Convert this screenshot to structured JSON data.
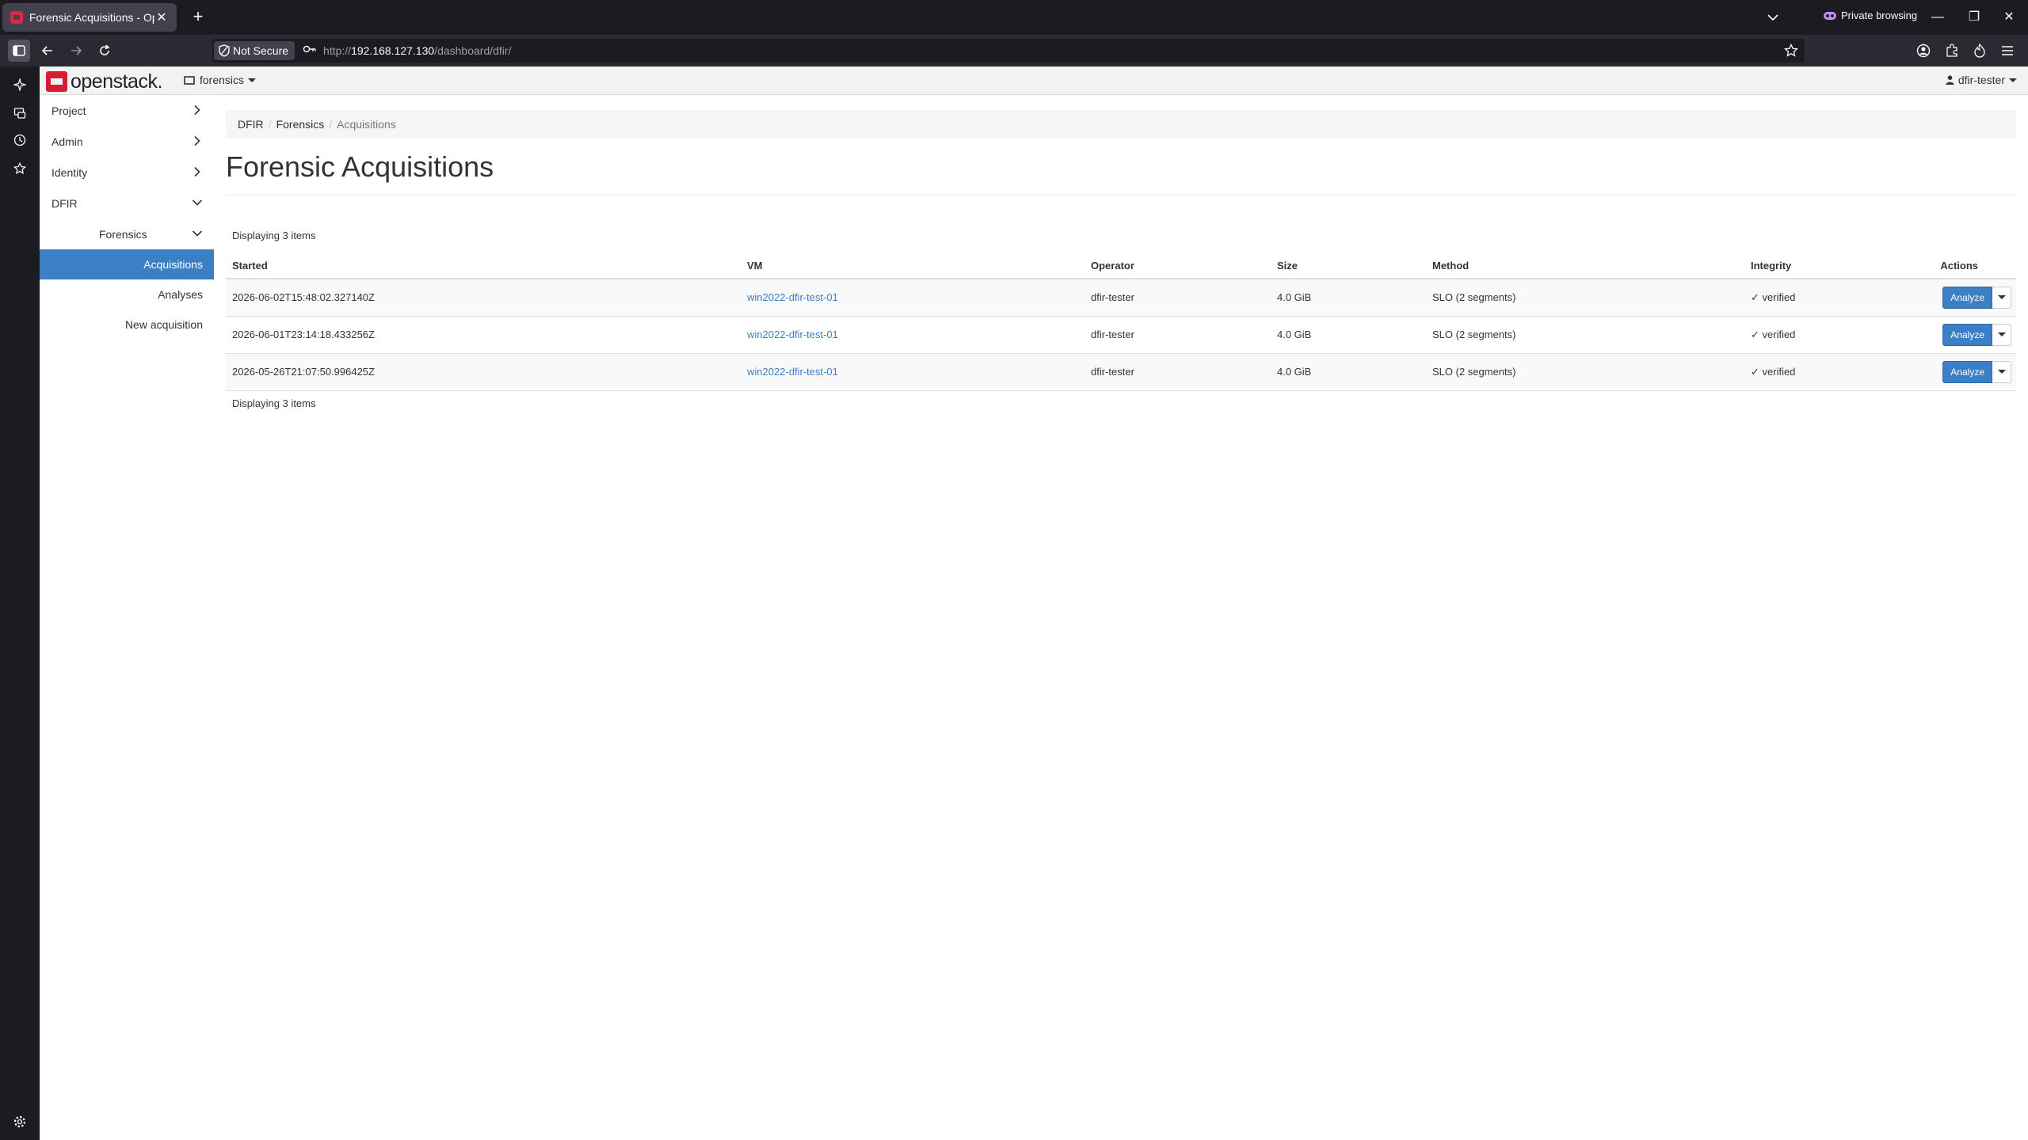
{
  "browser": {
    "tab_title": "Forensic Acquisitions - OpenSt",
    "new_tab_symbol": "+",
    "close_symbol": "✕",
    "private_label": "Private browsing",
    "not_secure_label": "Not Secure",
    "url_protocol": "http://",
    "url_host": "192.168.127.130",
    "url_path": "/dashboard/dfir/",
    "minimize_symbol": "—",
    "restore_symbol": "❐",
    "window_close_symbol": "✕"
  },
  "header": {
    "brand": "openstack.",
    "project": "forensics",
    "user": "dfir-tester"
  },
  "sidebar": {
    "panels": [
      {
        "label": "Project"
      },
      {
        "label": "Admin"
      },
      {
        "label": "Identity"
      },
      {
        "label": "DFIR"
      }
    ],
    "group": "Forensics",
    "items": [
      {
        "label": "Acquisitions",
        "active": true
      },
      {
        "label": "Analyses",
        "active": false
      },
      {
        "label": "New acquisition",
        "active": false
      }
    ]
  },
  "breadcrumb": [
    "DFIR",
    "Forensics",
    "Acquisitions"
  ],
  "page": {
    "title": "Forensic Acquisitions",
    "count_label": "Displaying 3 items"
  },
  "table": {
    "columns": [
      "Started",
      "VM",
      "Operator",
      "Size",
      "Method",
      "Integrity",
      "Actions"
    ],
    "rows": [
      {
        "started": "2026-06-02T15:48:02.327140Z",
        "vm": "win2022-dfir-test-01",
        "operator": "dfir-tester",
        "size": "4.0 GiB",
        "method": "SLO (2 segments)",
        "integrity": "✓ verified",
        "action": "Analyze"
      },
      {
        "started": "2026-06-01T23:14:18.433256Z",
        "vm": "win2022-dfir-test-01",
        "operator": "dfir-tester",
        "size": "4.0 GiB",
        "method": "SLO (2 segments)",
        "integrity": "✓ verified",
        "action": "Analyze"
      },
      {
        "started": "2026-05-26T21:07:50.996425Z",
        "vm": "win2022-dfir-test-01",
        "operator": "dfir-tester",
        "size": "4.0 GiB",
        "method": "SLO (2 segments)",
        "integrity": "✓ verified",
        "action": "Analyze"
      }
    ]
  },
  "colors": {
    "accent": "#3b7fc4",
    "brand_red": "#da1a32",
    "browser_dark": "#1c1b22"
  }
}
